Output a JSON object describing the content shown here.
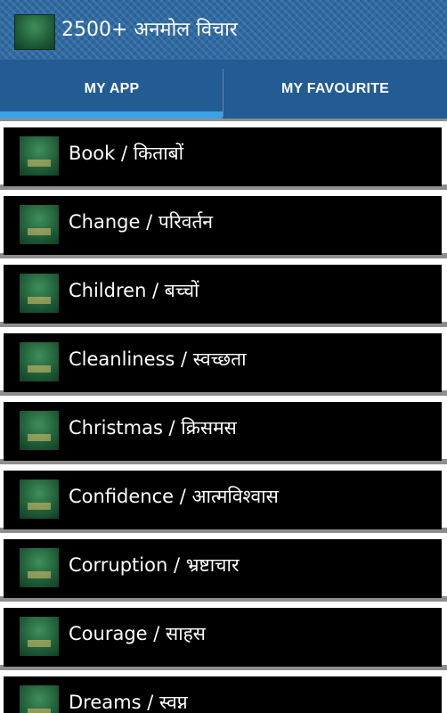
{
  "app": {
    "title": "2500+ अनमोल विचार",
    "logo_icon": "app-logo-icon"
  },
  "tabs": [
    {
      "label": "MY APP",
      "selected": true
    },
    {
      "label": "MY FAVOURITE",
      "selected": false
    }
  ],
  "colors": {
    "appbar": "#2e6aa3",
    "tabs": "#235b93",
    "indicator": "#3aa3e8",
    "card": "#000000"
  },
  "categories": [
    {
      "label": "Book / किताबों"
    },
    {
      "label": "Change / परिवर्तन"
    },
    {
      "label": "Children / बच्चों"
    },
    {
      "label": "Cleanliness / स्वच्छता"
    },
    {
      "label": "Christmas / क्रिसमस"
    },
    {
      "label": "Confidence / आत्मविश्वास"
    },
    {
      "label": "Corruption / भ्रष्टाचार"
    },
    {
      "label": "Courage / साहस"
    },
    {
      "label": "Dreams / स्वप्न"
    }
  ]
}
